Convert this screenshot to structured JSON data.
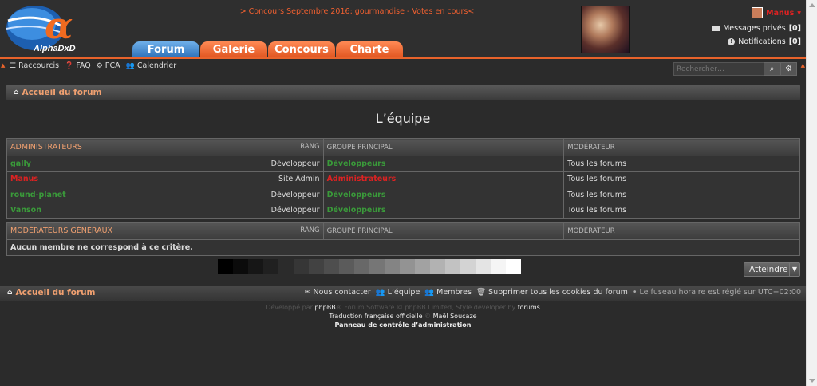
{
  "header": {
    "logo_alt": "AlphaDxD",
    "announcement": "> Concours Septembre 2016: gourmandise - Votes en cours<",
    "tabs": [
      "Forum",
      "Galerie",
      "Concours",
      "Charte"
    ],
    "user_name": "Manus",
    "user_arrow": "▾",
    "pm_label": "Messages privés",
    "pm_count": "[0]",
    "notif_label": "Notifications",
    "notif_count": "[0]"
  },
  "nav": {
    "links": [
      "Raccourcis",
      "FAQ",
      "PCA",
      "Calendrier"
    ],
    "search_placeholder": "Rechercher…"
  },
  "breadcrumb": "Accueil du forum",
  "page_title": "L’équipe",
  "groups": [
    {
      "name": "ADMINISTRATEURS",
      "col_rank": "RANG",
      "col_group": "GROUPE PRINCIPAL",
      "col_mod": "MODÉRATEUR",
      "rows": [
        {
          "user": "gally",
          "rank": "Développeur",
          "group": "Développeurs",
          "mod": "Tous les forums",
          "color": "#3a9a3a"
        },
        {
          "user": "Manus",
          "rank": "Site Admin",
          "group": "Administrateurs",
          "mod": "Tous les forums",
          "color": "#dd2222"
        },
        {
          "user": "round-planet",
          "rank": "Développeur",
          "group": "Développeurs",
          "mod": "Tous les forums",
          "color": "#3a9a3a"
        },
        {
          "user": "Vanson",
          "rank": "Développeur",
          "group": "Développeurs",
          "mod": "Tous les forums",
          "color": "#3a9a3a"
        }
      ]
    },
    {
      "name": "MODÉRATEURS GÉNÉRAUX",
      "col_rank": "RANG",
      "col_group": "GROUPE PRINCIPAL",
      "col_mod": "MODÉRATEUR",
      "empty": "Aucun membre ne correspond à ce critère."
    }
  ],
  "swatches": [
    "#000000",
    "#0b0b0b",
    "#161616",
    "#202020",
    "#2b2b2b",
    "#363636",
    "#424242",
    "#4e4e4e",
    "#5b5b5b",
    "#686868",
    "#767676",
    "#848484",
    "#939393",
    "#a2a2a2",
    "#b2b2b2",
    "#c2c2c2",
    "#d3d3d3",
    "#e4e4e4",
    "#f5f5f5",
    "#ffffff"
  ],
  "jump_label": "Atteindre",
  "footer": {
    "home": "Accueil du forum",
    "links": [
      "Nous contacter",
      "L’équipe",
      "Membres",
      "Supprimer tous les cookies du forum"
    ],
    "timezone": "• Le fuseau horaire est réglé sur UTC+02:00"
  },
  "credits": {
    "line1_a": "Développé par ",
    "line1_b": "phpBB",
    "line1_c": "® Forum Software © phpBB Limited, Style developer by ",
    "line1_d": "forums",
    "line2_a": "Traduction française officielle",
    "line2_b": " © ",
    "line2_c": "Maël Soucaze",
    "line3": "Panneau de contrôle d’administration"
  }
}
